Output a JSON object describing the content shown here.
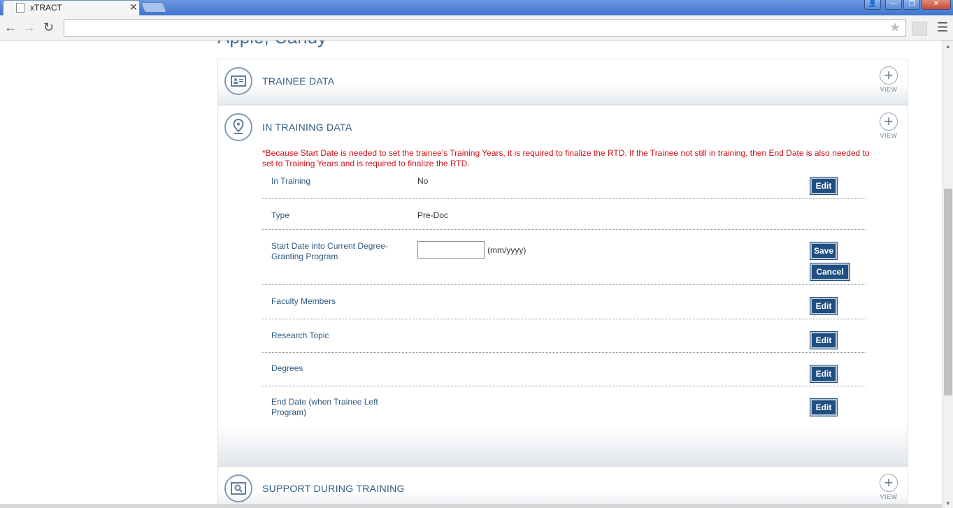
{
  "browser": {
    "tab_title": "xTRACT",
    "tab_close": "✕",
    "url": "",
    "win_user": "👤",
    "win_min": "—",
    "win_max": "❐",
    "win_close": "✕"
  },
  "page": {
    "person_name": "Apple, Candy"
  },
  "sections": {
    "trainee": {
      "title": "TRAINEE DATA",
      "view_label": "VIEW"
    },
    "training": {
      "title": "IN TRAINING DATA",
      "view_label": "VIEW",
      "notice": "*Because Start Date is needed to set the trainee's Training Years, it is required to finalize the RTD. If the Trainee not still in training, then End Date is also needed to set to Training Years and is required to finalize the RTD.",
      "rows": {
        "in_training": {
          "label": "In Training",
          "value": "No",
          "button": "Edit"
        },
        "type": {
          "label": "Type",
          "value": "Pre-Doc"
        },
        "start_date": {
          "label": "Start Date into Current Degree-Granting Program",
          "input_value": "",
          "hint": "(mm/yyyy)",
          "save": "Save",
          "cancel": "Cancel"
        },
        "faculty": {
          "label": "Faculty Members",
          "button": "Edit"
        },
        "research": {
          "label": "Research Topic",
          "button": "Edit"
        },
        "degrees": {
          "label": "Degrees",
          "button": "Edit"
        },
        "end_date": {
          "label": "End Date (when Trainee Left Program)",
          "button": "Edit"
        }
      }
    },
    "support": {
      "title": "SUPPORT DURING TRAINING",
      "view_label": "VIEW"
    }
  },
  "colors": {
    "accent": "#1f4f82",
    "heading": "#2f5c85",
    "notice": "#d2111b"
  }
}
